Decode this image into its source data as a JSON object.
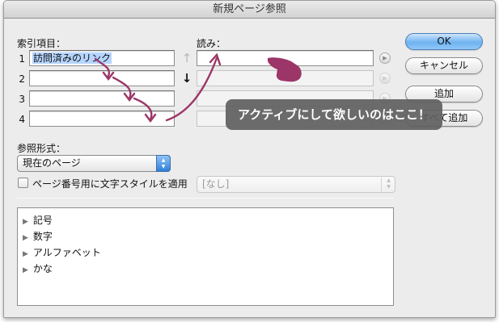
{
  "dialog": {
    "title": "新規ページ参照"
  },
  "index_entry": {
    "label": "索引項目：",
    "rows": [
      {
        "num": "1",
        "value": "訪問済みのリンク"
      },
      {
        "num": "2",
        "value": ""
      },
      {
        "num": "3",
        "value": ""
      },
      {
        "num": "4",
        "value": ""
      }
    ],
    "move_up_arrow": "↑",
    "move_down_arrow": "↓"
  },
  "reading": {
    "label": "読み：",
    "values": [
      "",
      "",
      "",
      ""
    ],
    "row_button_glyph": "▶"
  },
  "buttons": {
    "ok": "OK",
    "cancel": "キャンセル",
    "add": "追加",
    "add_all": "すべて追加"
  },
  "reference_type": {
    "label": "参照形式：",
    "selected": "現在のページ",
    "stepper_up": "▲",
    "stepper_down": "▼"
  },
  "char_style": {
    "checkbox_label": "ページ番号用に文字スタイルを適用",
    "checked": false,
    "style_selected": "[なし]"
  },
  "index_tree": {
    "items": [
      "記号",
      "数字",
      "アルファベット",
      "かな"
    ],
    "expand_glyph": "▶"
  },
  "tooltip": {
    "text": "アクティブにして欲しいのはここ！"
  },
  "annotation": {
    "arrow_color": "#9c3668",
    "tooltip_bg": "#606060"
  }
}
